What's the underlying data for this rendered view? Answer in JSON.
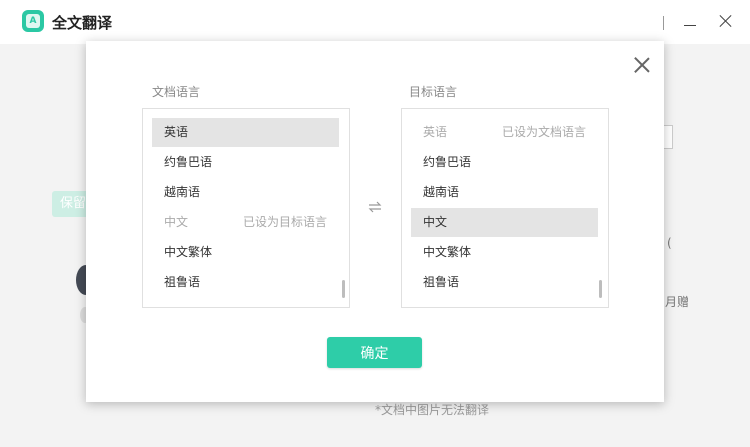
{
  "app": {
    "title": "全文翻译",
    "logo_text": "A"
  },
  "background": {
    "badge_text": "保留",
    "right_text_1": "(",
    "right_text_2": "月赠",
    "note": "*文档中图片无法翻译"
  },
  "dialog": {
    "source": {
      "label": "文档语言",
      "items": [
        {
          "name": "英语",
          "note": "",
          "state": "selected"
        },
        {
          "name": "约鲁巴语",
          "note": "",
          "state": "normal"
        },
        {
          "name": "越南语",
          "note": "",
          "state": "normal"
        },
        {
          "name": "中文",
          "note": "已设为目标语言",
          "state": "disabled"
        },
        {
          "name": "中文繁体",
          "note": "",
          "state": "normal"
        },
        {
          "name": "祖鲁语",
          "note": "",
          "state": "normal"
        }
      ]
    },
    "target": {
      "label": "目标语言",
      "items": [
        {
          "name": "英语",
          "note": "已设为文档语言",
          "state": "disabled"
        },
        {
          "name": "约鲁巴语",
          "note": "",
          "state": "normal"
        },
        {
          "name": "越南语",
          "note": "",
          "state": "normal"
        },
        {
          "name": "中文",
          "note": "",
          "state": "selected"
        },
        {
          "name": "中文繁体",
          "note": "",
          "state": "normal"
        },
        {
          "name": "祖鲁语",
          "note": "",
          "state": "normal"
        }
      ]
    },
    "confirm_label": "确定"
  },
  "colors": {
    "accent": "#2ecda8",
    "selected_bg": "#e4e4e4"
  },
  "icons": {
    "close": "close-icon",
    "swap": "swap-arrows-icon"
  }
}
